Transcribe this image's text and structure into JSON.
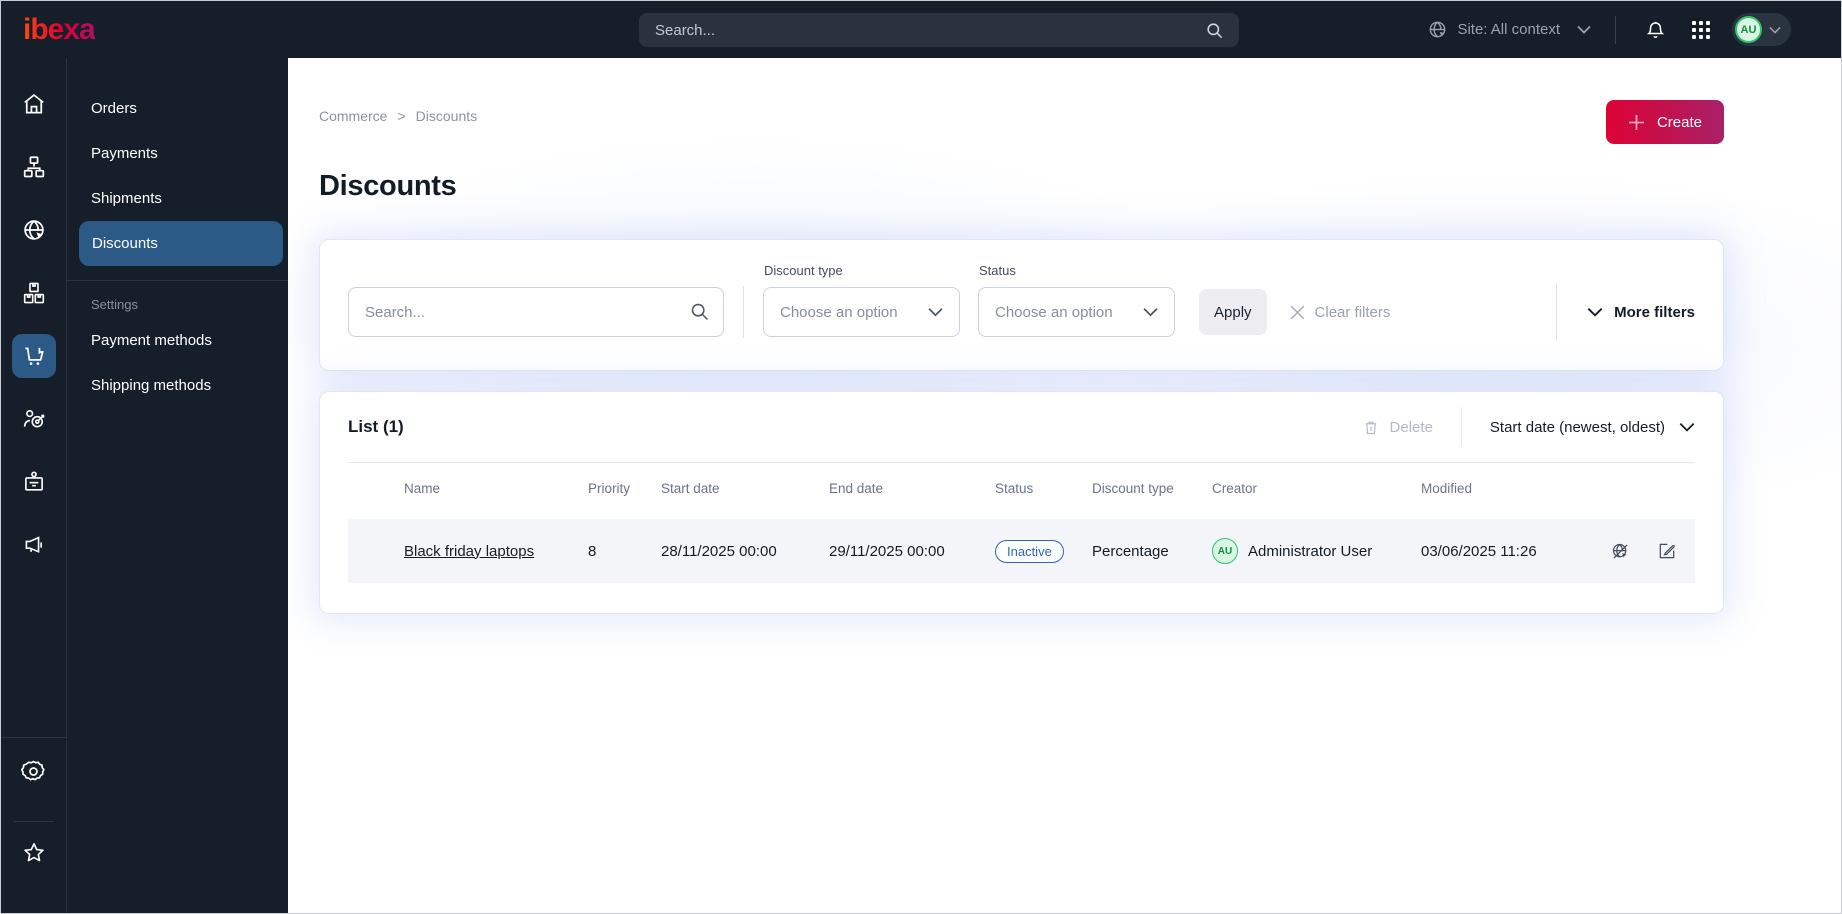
{
  "topbar": {
    "logo": "ibexa",
    "search_placeholder": "Search...",
    "site_selector": "Site: All context",
    "avatar_initials": "AU"
  },
  "sidebar": {
    "icons": [
      "home",
      "content-tree",
      "site",
      "products",
      "commerce",
      "customers",
      "corporate",
      "marketing",
      "settings",
      "bookmarks"
    ],
    "active_icon": "commerce"
  },
  "menu": {
    "items": {
      "orders": "Orders",
      "payments": "Payments",
      "shipments": "Shipments",
      "discounts": "Discounts"
    },
    "active": "Discounts",
    "settings_label": "Settings",
    "settings_items": {
      "payment_methods": "Payment methods",
      "shipping_methods": "Shipping methods"
    }
  },
  "breadcrumb": {
    "commerce": "Commerce",
    "separator": ">",
    "current": "Discounts"
  },
  "page": {
    "title": "Discounts",
    "create_label": "Create"
  },
  "filters": {
    "search_placeholder": "Search...",
    "discount_type_label": "Discount type",
    "discount_type_value": "Choose an option",
    "status_label": "Status",
    "status_value": "Choose an option",
    "apply_label": "Apply",
    "clear_label": "Clear filters",
    "more_label": "More filters"
  },
  "list": {
    "title": "List (1)",
    "delete_label": "Delete",
    "sort_label": "Start date (newest, oldest)",
    "columns": [
      "Name",
      "Priority",
      "Start date",
      "End date",
      "Status",
      "Discount type",
      "Creator",
      "Modified"
    ],
    "rows": [
      {
        "name": "Black friday laptops",
        "priority": "8",
        "start_date": "28/11/2025 00:00",
        "end_date": "29/11/2025 00:00",
        "status": "Inactive",
        "discount_type": "Percentage",
        "creator_initials": "AU",
        "creator": "Administrator User",
        "modified": "03/06/2025 11:26"
      }
    ]
  },
  "colors": {
    "topbar_bg": "#151e29",
    "active_nav_blue": "#2b5a87",
    "brand_gradient_start": "#db0032",
    "brand_gradient_end": "#ae1164",
    "status_badge_blue": "#3566b1",
    "avatar_green": "#2fc567"
  }
}
